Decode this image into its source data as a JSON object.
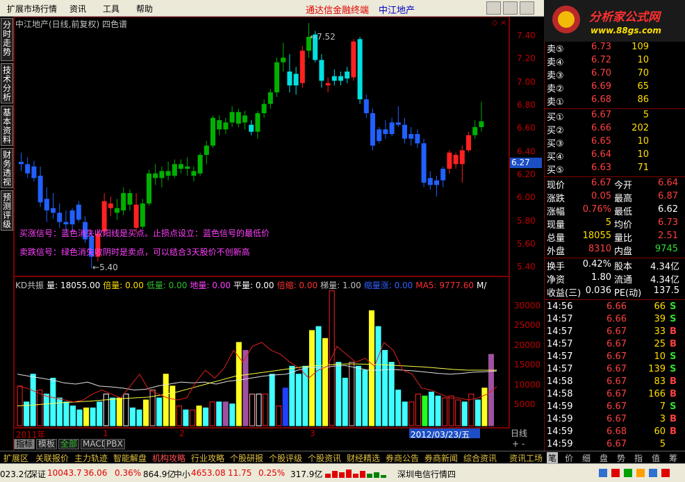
{
  "menubar": {
    "items": [
      "扩展市场行情",
      "资讯",
      "工具",
      "帮助"
    ],
    "app_title": "通达信金融终端",
    "stock_title": "中江地产",
    "brand_name": "分析家公式网",
    "brand_url": "www.88gs.com"
  },
  "left_tabs": [
    "分时走势",
    "技术分析",
    "基本资料",
    "财务透视",
    "预测评级"
  ],
  "chart": {
    "title": "中江地产(日线,前复权) 四色谱",
    "signal1": "买涨信号：蓝色消失收阳线是买点。止损点设立：蓝色信号的最低价",
    "signal2": "卖跌信号：绿色消失收阴时是卖点，可以结合3天股价不创新高",
    "high_mark": "7.52",
    "low_mark": "5.40",
    "current_price_tag": "6.27",
    "price_axis": [
      "7.40",
      "7.20",
      "7.00",
      "6.80",
      "6.60",
      "6.40",
      "6.20",
      "6.00",
      "5.80",
      "5.60",
      "5.40"
    ],
    "vol_axis": [
      "30000",
      "25000",
      "20000",
      "15000",
      "10000",
      "5000"
    ],
    "vol_header": [
      {
        "text": "KD共振",
        "color": "#c0c0c0"
      },
      {
        "text": "量: 18055.00",
        "color": "#ffffff"
      },
      {
        "text": "倍量: 0.00",
        "color": "#ffe000"
      },
      {
        "text": "低量: 0.00",
        "color": "#30c030"
      },
      {
        "text": "地量: 0.00",
        "color": "#ff40ff"
      },
      {
        "text": "平量: 0.00",
        "color": "#ffffff"
      },
      {
        "text": "倍缩: 0.00",
        "color": "#ff3030"
      },
      {
        "text": "梯量: 1.00",
        "color": "#c0c0c0"
      },
      {
        "text": "缩量涨: 0.00",
        "color": "#3060ff"
      },
      {
        "text": "MA5: 9777.60",
        "color": "#ff3030"
      },
      {
        "text": "M/",
        "color": "#ffffff"
      }
    ],
    "time_labels": [
      "2011年",
      "1",
      "2",
      "3"
    ],
    "date_box": "2012/03/23/五",
    "period": "日线",
    "candle_colors": {
      "up": "#ff2020",
      "down": "#00e0e0",
      "blue": "#2060ff",
      "green": "#00b000"
    },
    "vol_colors": {
      "red": "#ff2020",
      "cyan": "#40ffff",
      "yellow": "#ffff20",
      "white": "#ffffff",
      "blue": "#2040ff",
      "green": "#20ff20",
      "purple": "#a050a0",
      "pink": "#ffa0a0"
    }
  },
  "chart_data": {
    "type": "candlestick",
    "candles": [
      {
        "o": 6.32,
        "h": 6.4,
        "l": 6.24,
        "c": 6.3,
        "k": "blue"
      },
      {
        "o": 6.3,
        "h": 6.36,
        "l": 6.18,
        "c": 6.22,
        "k": "blue"
      },
      {
        "o": 6.28,
        "h": 6.33,
        "l": 6.15,
        "c": 6.18,
        "k": "blue"
      },
      {
        "o": 6.2,
        "h": 6.28,
        "l": 5.93,
        "c": 5.97,
        "k": "blue"
      },
      {
        "o": 6.0,
        "h": 6.1,
        "l": 5.8,
        "c": 5.9,
        "k": "blue"
      },
      {
        "o": 5.92,
        "h": 6.05,
        "l": 5.83,
        "c": 5.88,
        "k": "blue"
      },
      {
        "o": 5.88,
        "h": 5.96,
        "l": 5.75,
        "c": 5.8,
        "k": "blue"
      },
      {
        "o": 5.8,
        "h": 5.9,
        "l": 5.7,
        "c": 5.78,
        "k": "blue"
      },
      {
        "o": 5.78,
        "h": 5.92,
        "l": 5.72,
        "c": 5.9,
        "k": "blue"
      },
      {
        "o": 5.95,
        "h": 5.98,
        "l": 5.8,
        "c": 5.82,
        "k": "blue"
      },
      {
        "o": 5.8,
        "h": 5.85,
        "l": 5.62,
        "c": 5.65,
        "k": "blue"
      },
      {
        "o": 5.68,
        "h": 5.72,
        "l": 5.4,
        "c": 5.5,
        "k": "blue"
      },
      {
        "o": 5.5,
        "h": 5.72,
        "l": 5.46,
        "c": 5.7,
        "k": "up"
      },
      {
        "o": 5.72,
        "h": 6.05,
        "l": 5.68,
        "c": 5.98,
        "k": "up"
      },
      {
        "o": 5.96,
        "h": 6.02,
        "l": 5.85,
        "c": 5.92,
        "k": "up"
      },
      {
        "o": 5.92,
        "h": 6.0,
        "l": 5.82,
        "c": 5.88,
        "k": "green"
      },
      {
        "o": 5.9,
        "h": 6.1,
        "l": 5.86,
        "c": 6.05,
        "k": "green"
      },
      {
        "o": 6.05,
        "h": 6.08,
        "l": 5.9,
        "c": 5.95,
        "k": "green"
      },
      {
        "o": 5.95,
        "h": 6.05,
        "l": 5.7,
        "c": 5.75,
        "k": "up"
      },
      {
        "o": 5.76,
        "h": 6.0,
        "l": 5.74,
        "c": 5.96,
        "k": "green"
      },
      {
        "o": 5.96,
        "h": 6.25,
        "l": 5.94,
        "c": 6.22,
        "k": "green"
      },
      {
        "o": 6.22,
        "h": 6.3,
        "l": 6.12,
        "c": 6.18,
        "k": "green"
      },
      {
        "o": 6.18,
        "h": 6.28,
        "l": 6.1,
        "c": 6.24,
        "k": "green"
      },
      {
        "o": 6.24,
        "h": 6.32,
        "l": 6.16,
        "c": 6.2,
        "k": "green"
      },
      {
        "o": 6.2,
        "h": 6.34,
        "l": 6.18,
        "c": 6.3,
        "k": "green"
      },
      {
        "o": 6.3,
        "h": 6.34,
        "l": 6.22,
        "c": 6.26,
        "k": "green"
      },
      {
        "o": 6.26,
        "h": 6.36,
        "l": 6.2,
        "c": 6.28,
        "k": "green"
      },
      {
        "o": 6.24,
        "h": 6.28,
        "l": 6.15,
        "c": 6.2,
        "k": "green"
      },
      {
        "o": 6.22,
        "h": 6.4,
        "l": 6.2,
        "c": 6.38,
        "k": "green"
      },
      {
        "o": 6.38,
        "h": 6.5,
        "l": 6.3,
        "c": 6.46,
        "k": "green"
      },
      {
        "o": 6.46,
        "h": 6.72,
        "l": 6.44,
        "c": 6.7,
        "k": "green"
      },
      {
        "o": 6.68,
        "h": 6.72,
        "l": 6.55,
        "c": 6.6,
        "k": "green"
      },
      {
        "o": 6.6,
        "h": 6.7,
        "l": 6.56,
        "c": 6.66,
        "k": "green"
      },
      {
        "o": 6.66,
        "h": 6.8,
        "l": 6.62,
        "c": 6.75,
        "k": "green"
      },
      {
        "o": 6.75,
        "h": 6.78,
        "l": 6.62,
        "c": 6.65,
        "k": "green"
      },
      {
        "o": 6.66,
        "h": 6.76,
        "l": 6.6,
        "c": 6.72,
        "k": "green"
      },
      {
        "o": 6.64,
        "h": 6.68,
        "l": 6.55,
        "c": 6.58,
        "k": "down"
      },
      {
        "o": 6.58,
        "h": 6.76,
        "l": 6.52,
        "c": 6.74,
        "k": "green"
      },
      {
        "o": 6.74,
        "h": 6.86,
        "l": 6.7,
        "c": 6.82,
        "k": "green"
      },
      {
        "o": 6.82,
        "h": 6.95,
        "l": 6.78,
        "c": 6.92,
        "k": "green"
      },
      {
        "o": 6.92,
        "h": 7.22,
        "l": 6.88,
        "c": 7.18,
        "k": "green"
      },
      {
        "o": 7.18,
        "h": 7.35,
        "l": 7.1,
        "c": 7.22,
        "k": "green"
      },
      {
        "o": 7.1,
        "h": 7.25,
        "l": 6.92,
        "c": 6.98,
        "k": "down"
      },
      {
        "o": 6.98,
        "h": 7.14,
        "l": 6.9,
        "c": 7.08,
        "k": "down"
      },
      {
        "o": 7.0,
        "h": 7.32,
        "l": 6.96,
        "c": 7.28,
        "k": "up"
      },
      {
        "o": 7.28,
        "h": 7.52,
        "l": 7.22,
        "c": 7.4,
        "k": "green"
      },
      {
        "o": 7.42,
        "h": 7.45,
        "l": 7.18,
        "c": 7.2,
        "k": "down"
      },
      {
        "o": 7.2,
        "h": 7.25,
        "l": 6.96,
        "c": 7.02,
        "k": "down"
      },
      {
        "o": 7.0,
        "h": 7.05,
        "l": 6.92,
        "c": 6.98,
        "k": "up"
      },
      {
        "o": 7.02,
        "h": 7.12,
        "l": 6.98,
        "c": 7.06,
        "k": "down"
      },
      {
        "o": 7.06,
        "h": 7.1,
        "l": 6.98,
        "c": 7.02,
        "k": "down"
      },
      {
        "o": 7.04,
        "h": 7.14,
        "l": 7.0,
        "c": 7.1,
        "k": "down"
      },
      {
        "o": 7.05,
        "h": 7.38,
        "l": 7.02,
        "c": 7.36,
        "k": "up"
      },
      {
        "o": 7.38,
        "h": 7.4,
        "l": 6.82,
        "c": 6.86,
        "k": "down"
      },
      {
        "o": 6.86,
        "h": 6.9,
        "l": 6.7,
        "c": 6.74,
        "k": "blue"
      },
      {
        "o": 6.74,
        "h": 6.78,
        "l": 6.42,
        "c": 6.46,
        "k": "blue"
      },
      {
        "o": 6.5,
        "h": 6.62,
        "l": 6.48,
        "c": 6.6,
        "k": "blue"
      },
      {
        "o": 6.6,
        "h": 6.68,
        "l": 6.52,
        "c": 6.56,
        "k": "blue"
      },
      {
        "o": 6.56,
        "h": 6.7,
        "l": 6.54,
        "c": 6.66,
        "k": "blue"
      },
      {
        "o": 6.66,
        "h": 6.8,
        "l": 6.62,
        "c": 6.64,
        "k": "blue"
      },
      {
        "o": 6.64,
        "h": 6.7,
        "l": 6.48,
        "c": 6.52,
        "k": "blue"
      },
      {
        "o": 6.52,
        "h": 6.62,
        "l": 6.46,
        "c": 6.56,
        "k": "blue"
      },
      {
        "o": 6.56,
        "h": 6.6,
        "l": 6.44,
        "c": 6.48,
        "k": "blue"
      },
      {
        "o": 6.48,
        "h": 6.52,
        "l": 6.1,
        "c": 6.14,
        "k": "blue"
      },
      {
        "o": 6.18,
        "h": 6.24,
        "l": 6.08,
        "c": 6.12,
        "k": "blue"
      },
      {
        "o": 6.12,
        "h": 6.2,
        "l": 6.02,
        "c": 6.16,
        "k": "blue"
      },
      {
        "o": 6.16,
        "h": 6.28,
        "l": 6.1,
        "c": 6.26,
        "k": "blue"
      },
      {
        "o": 6.26,
        "h": 6.42,
        "l": 6.22,
        "c": 6.4,
        "k": "up"
      },
      {
        "o": 6.38,
        "h": 6.4,
        "l": 6.26,
        "c": 6.3,
        "k": "up"
      },
      {
        "o": 6.3,
        "h": 6.46,
        "l": 6.14,
        "c": 6.42,
        "k": "up"
      },
      {
        "o": 6.42,
        "h": 6.58,
        "l": 6.4,
        "c": 6.55,
        "k": "up"
      },
      {
        "o": 6.55,
        "h": 6.68,
        "l": 6.52,
        "c": 6.62,
        "k": "green"
      },
      {
        "o": 6.62,
        "h": 6.84,
        "l": 6.58,
        "c": 6.67,
        "k": "green"
      }
    ],
    "volumes": [
      [
        10000,
        "red"
      ],
      [
        6000,
        "cyan"
      ],
      [
        13000,
        "cyan"
      ],
      [
        9000,
        "red"
      ],
      [
        8000,
        "cyan"
      ],
      [
        12000,
        "cyan"
      ],
      [
        7000,
        "cyan"
      ],
      [
        6000,
        "cyan"
      ],
      [
        5000,
        "cyan"
      ],
      [
        4000,
        "cyan"
      ],
      [
        4500,
        "yellow"
      ],
      [
        4500,
        "cyan"
      ],
      [
        6000,
        "cyan"
      ],
      [
        8000,
        "white"
      ],
      [
        7000,
        "cyan"
      ],
      [
        7000,
        "yellow"
      ],
      [
        8000,
        "white"
      ],
      [
        4500,
        "cyan"
      ],
      [
        4000,
        "cyan"
      ],
      [
        6500,
        "yellow"
      ],
      [
        9000,
        "pink"
      ],
      [
        7000,
        "cyan"
      ],
      [
        13000,
        "yellow"
      ],
      [
        10000,
        "yellow"
      ],
      [
        5000,
        "red"
      ],
      [
        4000,
        "cyan"
      ],
      [
        4000,
        "red"
      ],
      [
        5000,
        "yellow"
      ],
      [
        4500,
        "cyan"
      ],
      [
        6000,
        "red"
      ],
      [
        6000,
        "cyan"
      ],
      [
        6000,
        "purple"
      ],
      [
        5500,
        "cyan"
      ],
      [
        21000,
        "yellow"
      ],
      [
        19000,
        "purple"
      ],
      [
        8000,
        "pink"
      ],
      [
        8000,
        "white"
      ],
      [
        8000,
        "red"
      ],
      [
        13000,
        "cyan"
      ],
      [
        5000,
        "red"
      ],
      [
        9500,
        "blue"
      ],
      [
        15000,
        "cyan"
      ],
      [
        13000,
        "cyan"
      ],
      [
        15000,
        "cyan"
      ],
      [
        24000,
        "yellow"
      ],
      [
        25000,
        "cyan"
      ],
      [
        22000,
        "yellow"
      ],
      [
        34000,
        "red"
      ],
      [
        16000,
        "cyan"
      ],
      [
        12000,
        "cyan"
      ],
      [
        16000,
        "pink"
      ],
      [
        15000,
        "cyan"
      ],
      [
        14000,
        "cyan"
      ],
      [
        29000,
        "yellow"
      ],
      [
        25000,
        "cyan"
      ],
      [
        19000,
        "cyan"
      ],
      [
        16000,
        "cyan"
      ],
      [
        9000,
        "cyan"
      ],
      [
        6000,
        "cyan"
      ],
      [
        6000,
        "red"
      ],
      [
        8000,
        "red"
      ],
      [
        7500,
        "green"
      ],
      [
        8500,
        "cyan"
      ],
      [
        7500,
        "cyan"
      ],
      [
        7000,
        "red"
      ],
      [
        7500,
        "red"
      ],
      [
        6500,
        "red"
      ],
      [
        6000,
        "cyan"
      ],
      [
        8000,
        "red"
      ],
      [
        6500,
        "cyan"
      ],
      [
        9500,
        "yellow"
      ],
      [
        18000,
        "purple"
      ]
    ],
    "ma_white_y": [
      13000,
      12500,
      12000,
      11500,
      10800,
      10500,
      11000,
      10000,
      9800,
      9500,
      9000,
      9200,
      10000,
      10500,
      11000,
      10800,
      11000,
      10500,
      11200,
      11500,
      12000,
      12500,
      12800,
      13000,
      14000,
      14800,
      14500,
      15000,
      15200,
      14600,
      14000,
      14000,
      14200,
      14000,
      13800,
      13500,
      13200,
      13000,
      13200,
      13500,
      13600,
      13800
    ],
    "ma_yellow_y": [
      5000,
      5200,
      5500,
      5800,
      6000,
      6200,
      6500,
      6800,
      7000,
      7200,
      7800,
      8500,
      9500,
      10500,
      11500,
      12500,
      13000,
      13500,
      14000,
      14500,
      15000,
      15200,
      15500,
      15600,
      15500,
      15400,
      15200,
      15000,
      14800,
      14500,
      14200,
      14000,
      14000,
      14000
    ],
    "ma_red_y": [
      10000,
      9500,
      8500,
      7500,
      7000,
      6500,
      6000,
      6500,
      8000,
      9000,
      8000,
      7000,
      10000,
      13000,
      9000,
      8000,
      7000,
      6500,
      7000,
      11000,
      14000,
      12000,
      14500,
      19000,
      16000,
      20000,
      21000,
      19000,
      18000,
      16000,
      14500,
      12000,
      14000,
      15000,
      20000,
      18000,
      16000,
      17000,
      15000,
      21000,
      19000,
      14000,
      13000,
      9500,
      9000,
      8000,
      7000,
      7000,
      6500,
      7000,
      8000,
      9800
    ]
  },
  "quote": {
    "sell": [
      {
        "label": "卖⑤",
        "price": "6.73",
        "vol": "109"
      },
      {
        "label": "卖④",
        "price": "6.72",
        "vol": "10"
      },
      {
        "label": "卖③",
        "price": "6.70",
        "vol": "70"
      },
      {
        "label": "卖②",
        "price": "6.69",
        "vol": "65"
      },
      {
        "label": "卖①",
        "price": "6.68",
        "vol": "86"
      }
    ],
    "buy": [
      {
        "label": "买①",
        "price": "6.67",
        "vol": "5"
      },
      {
        "label": "买②",
        "price": "6.66",
        "vol": "202"
      },
      {
        "label": "买③",
        "price": "6.65",
        "vol": "10"
      },
      {
        "label": "买④",
        "price": "6.64",
        "vol": "10"
      },
      {
        "label": "买⑤",
        "price": "6.63",
        "vol": "71"
      }
    ],
    "stats": [
      {
        "l1": "现价",
        "v1": "6.67",
        "c1": "#ff4040",
        "l2": "今开",
        "v2": "6.64",
        "c2": "#ff4040"
      },
      {
        "l1": "涨跌",
        "v1": "0.05",
        "c1": "#ff4040",
        "l2": "最高",
        "v2": "6.87",
        "c2": "#ff4040"
      },
      {
        "l1": "涨幅",
        "v1": "0.76%",
        "c1": "#ff4040",
        "l2": "最低",
        "v2": "6.62",
        "c2": "#ffffff"
      },
      {
        "l1": "现量",
        "v1": "5",
        "c1": "#ffe000",
        "l2": "均价",
        "v2": "6.73",
        "c2": "#ff4040"
      },
      {
        "l1": "总量",
        "v1": "18055",
        "c1": "#ffe000",
        "l2": "量比",
        "v2": "2.51",
        "c2": "#ff4040"
      },
      {
        "l1": "外盘",
        "v1": "8310",
        "c1": "#ff4040",
        "l2": "内盘",
        "v2": "9745",
        "c2": "#30e030"
      }
    ],
    "stats2": [
      {
        "l1": "换手",
        "v1": "0.42%",
        "l2": "股本",
        "v2": "4.34亿"
      },
      {
        "l1": "净资",
        "v1": "1.80",
        "l2": "流通",
        "v2": "4.34亿"
      },
      {
        "l1": "收益(三)",
        "v1": "0.036",
        "l2": "PE(动)",
        "v2": "137.5"
      }
    ],
    "ticks": [
      {
        "time": "14:56",
        "price": "6.66",
        "vol": "66",
        "dir": "S"
      },
      {
        "time": "14:57",
        "price": "6.66",
        "vol": "39",
        "dir": "S"
      },
      {
        "time": "14:57",
        "price": "6.67",
        "vol": "33",
        "dir": "B"
      },
      {
        "time": "14:57",
        "price": "6.67",
        "vol": "25",
        "dir": "B"
      },
      {
        "time": "14:57",
        "price": "6.67",
        "vol": "10",
        "dir": "S"
      },
      {
        "time": "14:57",
        "price": "6.67",
        "vol": "139",
        "dir": "S"
      },
      {
        "time": "14:58",
        "price": "6.67",
        "vol": "83",
        "dir": "B"
      },
      {
        "time": "14:58",
        "price": "6.67",
        "vol": "166",
        "dir": "B"
      },
      {
        "time": "14:59",
        "price": "6.67",
        "vol": "7",
        "dir": "S"
      },
      {
        "time": "14:59",
        "price": "6.67",
        "vol": "3",
        "dir": "B"
      },
      {
        "time": "14:59",
        "price": "6.68",
        "vol": "60",
        "dir": "B"
      },
      {
        "time": "14:59",
        "price": "6.67",
        "vol": "5",
        "dir": ""
      }
    ]
  },
  "bottom_tabs": [
    "指标",
    "模板",
    "全部",
    "MACD",
    "PBX"
  ],
  "zoom": "+ -",
  "func_items": [
    "扩展区",
    "关联报价",
    "主力轨迹",
    "智能解盘",
    "机构攻略",
    "行业攻略",
    "个股研报",
    "个股评级",
    "个股资讯",
    "财经精选",
    "券商公告",
    "券商新闻",
    "综合资讯",
    "资讯工场"
  ],
  "right_tabs": [
    "笔",
    "价",
    "细",
    "盘",
    "势",
    "指",
    "值",
    "筹"
  ],
  "status": {
    "sh_tail": "023.2亿",
    "sz_label": "深证",
    "sz_index": "10043.7",
    "sz_chg": "36.06",
    "sz_pct": "0.36%",
    "sz_amt": "864.9亿",
    "zx_label": "中小",
    "zx_index": "4653.08",
    "zx_chg": "11.75",
    "zx_pct": "0.25%",
    "zx_amt": "317.9亿",
    "server": "深圳电信行情四"
  }
}
